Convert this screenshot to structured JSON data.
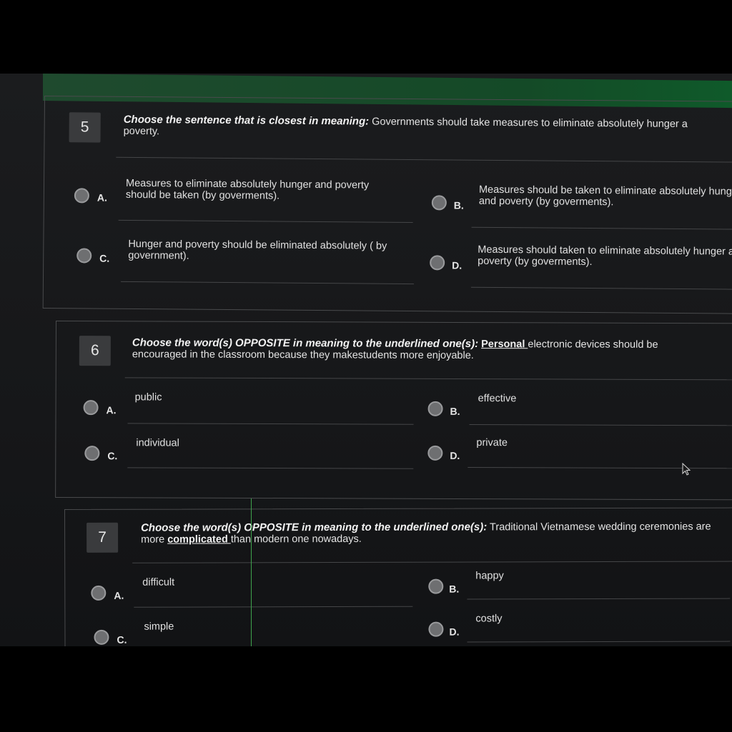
{
  "questions": [
    {
      "number": "5",
      "instruction": "Choose the sentence that is closest in meaning:",
      "text": " Governments should take measures to eliminate absolutely hunger a",
      "text2": "poverty.",
      "options": [
        {
          "letter": "A.",
          "text": "Measures to eliminate absolutely hunger and poverty",
          "text2": "should be taken (by goverments)."
        },
        {
          "letter": "B.",
          "text": "Measures should be taken to eliminate absolutely hunge",
          "text2": "and poverty (by goverments)."
        },
        {
          "letter": "C.",
          "text": "Hunger and poverty should be eliminated absolutely ( by",
          "text2": "government)."
        },
        {
          "letter": "D.",
          "text": "Measures should taken to eliminate absolutely hunger ar",
          "text2": "poverty (by goverments)."
        }
      ]
    },
    {
      "number": "6",
      "instruction": "Choose the word(s) OPPOSITE in meaning to the underlined one(s):",
      "underlined": "Personal ",
      "text": " electronic devices should be",
      "text2": "encouraged in the classroom because they makestudents more enjoyable.",
      "options": [
        {
          "letter": "A.",
          "text": "public"
        },
        {
          "letter": "B.",
          "text": "effective"
        },
        {
          "letter": "C.",
          "text": "individual"
        },
        {
          "letter": "D.",
          "text": "private"
        }
      ]
    },
    {
      "number": "7",
      "instruction": "Choose the word(s) OPPOSITE in meaning to the underlined one(s):",
      "text": " Traditional Vietnamese wedding ceremonies are",
      "text2a": "more ",
      "underlined": " complicated ",
      "text2b": " than modern one nowadays.",
      "options": [
        {
          "letter": "A.",
          "text": "difficult"
        },
        {
          "letter": "B.",
          "text": "happy"
        },
        {
          "letter": "C.",
          "text": "simple"
        },
        {
          "letter": "D.",
          "text": "costly"
        }
      ]
    }
  ],
  "colors": {
    "topbar": "#144a27",
    "accent_line": "#3fa34d"
  }
}
